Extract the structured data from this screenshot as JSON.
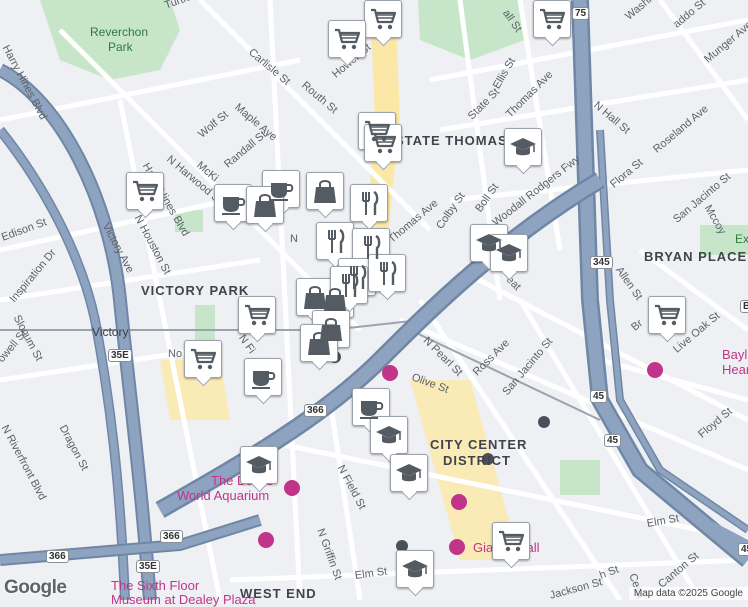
{
  "map": {
    "colors": {
      "background": "#eef0f3",
      "freeway": "#8da3bf",
      "freeway_edge": "#6f87a6",
      "street": "#ffffff",
      "park": "#c7e6c9",
      "highlight_street": "#fbe8a6",
      "rail": "#9ca3ad"
    },
    "districts": [
      {
        "id": "state-thomas",
        "text": "STATE THOMAS"
      },
      {
        "id": "bryan-place",
        "text": "BRYAN PLACE"
      },
      {
        "id": "victory-park",
        "text": "VICTORY PARK"
      },
      {
        "id": "city-center",
        "text": "CITY CENTER"
      },
      {
        "id": "city-center-2",
        "text": "DISTRICT"
      },
      {
        "id": "west-end",
        "text": "WEST END"
      }
    ],
    "parks": [
      {
        "id": "reverchon",
        "line1": "Reverchon",
        "line2": "Park"
      }
    ],
    "streets": [
      {
        "id": "harry-hines-top",
        "text": "Harry Hines Blvd"
      },
      {
        "id": "maple",
        "text": "Maple Ave"
      },
      {
        "id": "carlisle",
        "text": "Carlisle St"
      },
      {
        "id": "routh",
        "text": "Routh St"
      },
      {
        "id": "howell",
        "text": "Howell St"
      },
      {
        "id": "wolf",
        "text": "Wolf St"
      },
      {
        "id": "randall",
        "text": "Randall St"
      },
      {
        "id": "mckinney",
        "text": "McKi"
      },
      {
        "id": "n-harwood",
        "text": "N Harwood St"
      },
      {
        "id": "harry-hines-mid",
        "text": "Harry Hines Blvd"
      },
      {
        "id": "edison",
        "text": "Edison St"
      },
      {
        "id": "victory-ave",
        "text": "Victory Ave"
      },
      {
        "id": "n-houston",
        "text": "N Houston St"
      },
      {
        "id": "inspiration",
        "text": "Inspiration Dr"
      },
      {
        "id": "slocum",
        "text": "Slocum St"
      },
      {
        "id": "howell-w",
        "text": "owell St"
      },
      {
        "id": "n-riverfront",
        "text": "N Riverfront Blvd"
      },
      {
        "id": "dragon",
        "text": "Dragon St"
      },
      {
        "id": "no",
        "text": "No"
      },
      {
        "id": "n-field-top",
        "text": "N Fi"
      },
      {
        "id": "n-field",
        "text": "N Field St"
      },
      {
        "id": "n-griffin",
        "text": "N Griffin St"
      },
      {
        "id": "elm-left",
        "text": "Elm St"
      },
      {
        "id": "elm-right",
        "text": "Elm St"
      },
      {
        "id": "thomas",
        "text": "Thomas Ave"
      },
      {
        "id": "thomas-top",
        "text": "Thomas Ave"
      },
      {
        "id": "state",
        "text": "State St"
      },
      {
        "id": "ellis",
        "text": "Ellis St"
      },
      {
        "id": "colby",
        "text": "Colby St"
      },
      {
        "id": "boll",
        "text": "Boll St"
      },
      {
        "id": "woodall",
        "text": "Woodall Rodgers Fwy"
      },
      {
        "id": "n-pearl",
        "text": "N Pearl St"
      },
      {
        "id": "olive",
        "text": "Olive St"
      },
      {
        "id": "ross",
        "text": "Ross Ave"
      },
      {
        "id": "san-jacinto",
        "text": "San Jacinto St"
      },
      {
        "id": "n-hall",
        "text": "N Hall St"
      },
      {
        "id": "washington",
        "text": "Washington Ave"
      },
      {
        "id": "munger",
        "text": "Munger Ave"
      },
      {
        "id": "roseland",
        "text": "Roseland Ave"
      },
      {
        "id": "flora",
        "text": "Flora St"
      },
      {
        "id": "san-jacinto-e",
        "text": "San Jacinto St"
      },
      {
        "id": "mccoy",
        "text": "Mccoy"
      },
      {
        "id": "allen",
        "text": "Allen St"
      },
      {
        "id": "live-oak",
        "text": "Live Oak St"
      },
      {
        "id": "floyd",
        "text": "Floyd St"
      },
      {
        "id": "canton",
        "text": "Canton St"
      },
      {
        "id": "cesar",
        "text": "Cesa"
      },
      {
        "id": "jackson",
        "text": "Jackson St"
      },
      {
        "id": "turtle",
        "text": "Turtle"
      },
      {
        "id": "all",
        "text": "all St"
      },
      {
        "id": "caddo",
        "text": "addo St"
      },
      {
        "id": "n-pearl-top",
        "text": "N P"
      },
      {
        "id": "eat",
        "text": "eat"
      },
      {
        "id": "br",
        "text": "Br"
      },
      {
        "id": "n-st",
        "text": "N"
      },
      {
        "id": "hn-st",
        "text": "h St"
      }
    ],
    "pois": [
      {
        "id": "aquarium",
        "line1": "The Dallas",
        "line2": "World Aquarium"
      },
      {
        "id": "sixth-floor",
        "line1": "The Sixth Floor",
        "line2": "Museum at Dealey Plaza"
      },
      {
        "id": "giant-eyeball",
        "text": "Gia   Eyeball"
      },
      {
        "id": "baylor",
        "line1": "Bayl",
        "line2": "Hear"
      },
      {
        "id": "victory-station",
        "text": "Victory"
      },
      {
        "id": "ex",
        "text": "Ex"
      }
    ],
    "route_shields": [
      "75",
      "366",
      "366",
      "345",
      "35E",
      "35E",
      "366",
      "366",
      "45",
      "45",
      "45",
      "B"
    ],
    "markers": [
      {
        "id": "m1",
        "icon": "cart"
      },
      {
        "id": "m2",
        "icon": "cart"
      },
      {
        "id": "m3",
        "icon": "cart"
      },
      {
        "id": "m4",
        "icon": "cart"
      },
      {
        "id": "m5",
        "icon": "cart"
      },
      {
        "id": "m6",
        "icon": "cart"
      },
      {
        "id": "m7",
        "icon": "cart"
      },
      {
        "id": "m8",
        "icon": "cart"
      },
      {
        "id": "m9",
        "icon": "cart"
      },
      {
        "id": "m10",
        "icon": "cart"
      },
      {
        "id": "m11",
        "icon": "cup"
      },
      {
        "id": "m12",
        "icon": "cup"
      },
      {
        "id": "m13",
        "icon": "cup"
      },
      {
        "id": "m14",
        "icon": "cup"
      },
      {
        "id": "m15",
        "icon": "bag"
      },
      {
        "id": "m16",
        "icon": "bag"
      },
      {
        "id": "m17",
        "icon": "bag"
      },
      {
        "id": "m18",
        "icon": "bag"
      },
      {
        "id": "m19",
        "icon": "bag"
      },
      {
        "id": "m20",
        "icon": "bag"
      },
      {
        "id": "m21",
        "icon": "fork"
      },
      {
        "id": "m22",
        "icon": "fork"
      },
      {
        "id": "m23",
        "icon": "fork"
      },
      {
        "id": "m24",
        "icon": "fork"
      },
      {
        "id": "m25",
        "icon": "fork"
      },
      {
        "id": "m26",
        "icon": "fork"
      },
      {
        "id": "m27",
        "icon": "school"
      },
      {
        "id": "m28",
        "icon": "school"
      },
      {
        "id": "m29",
        "icon": "school"
      },
      {
        "id": "m30",
        "icon": "school"
      },
      {
        "id": "m31",
        "icon": "school"
      },
      {
        "id": "m32",
        "icon": "school"
      },
      {
        "id": "m33",
        "icon": "school"
      }
    ],
    "google_logo": "Google",
    "attribution": "Map data ©2025 Google"
  }
}
